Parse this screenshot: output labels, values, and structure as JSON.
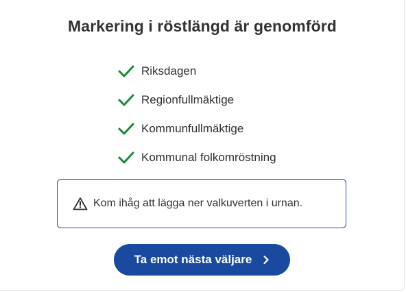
{
  "header": {
    "title": "Markering i röstlängd är genomförd"
  },
  "elections": [
    {
      "label": "Riksdagen",
      "icon": "checkmark-icon"
    },
    {
      "label": "Regionfullmäktige",
      "icon": "checkmark-icon"
    },
    {
      "label": "Kommunfullmäktige",
      "icon": "checkmark-icon"
    },
    {
      "label": "Kommunal folkomröstning",
      "icon": "checkmark-icon"
    }
  ],
  "notice": {
    "icon": "warning-icon",
    "text": "Kom ihåg att lägga ner valkuverten i urnan."
  },
  "actions": {
    "next_label": "Ta emot nästa väljare",
    "next_icon": "chevron-right-icon"
  },
  "colors": {
    "check": "#138a36",
    "primary": "#1a4aa0",
    "notice_border": "#1f4e9a",
    "text": "#2f2f2f"
  }
}
